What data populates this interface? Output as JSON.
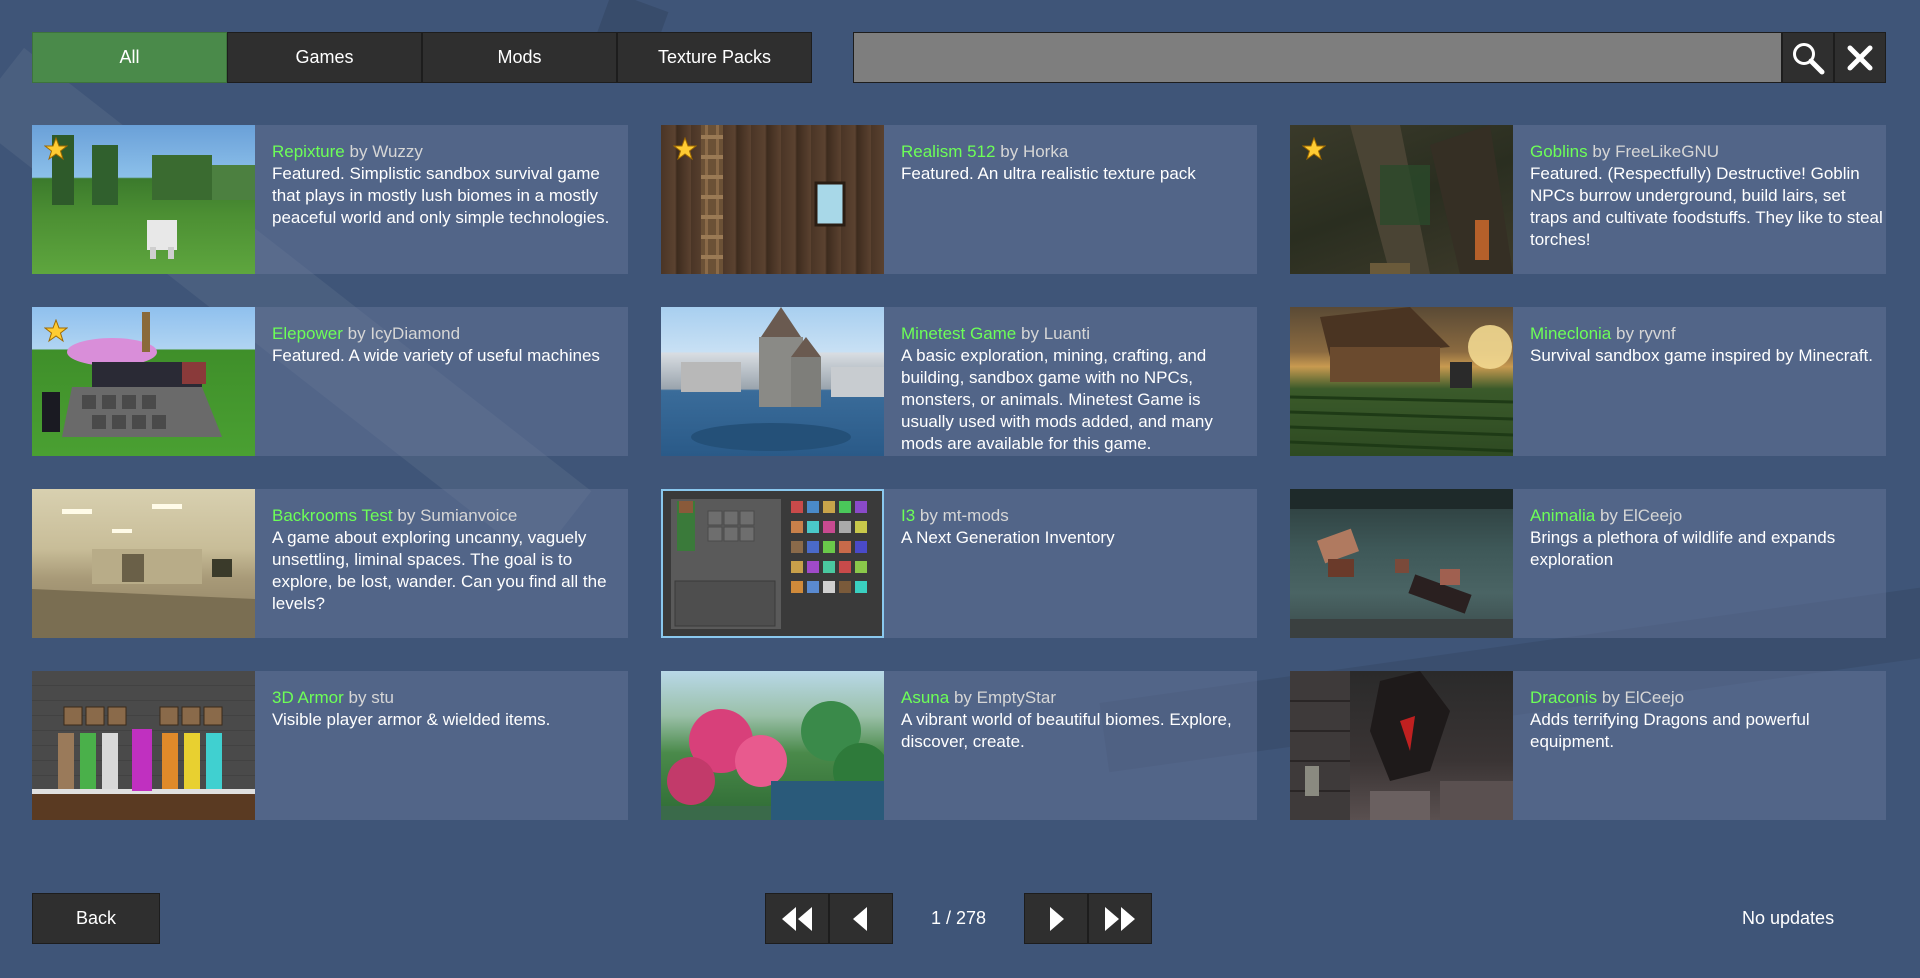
{
  "tabs": [
    {
      "label": "All",
      "active": true
    },
    {
      "label": "Games",
      "active": false
    },
    {
      "label": "Mods",
      "active": false
    },
    {
      "label": "Texture Packs",
      "active": false
    }
  ],
  "search": {
    "value": "",
    "placeholder": "",
    "search_icon": "magnifier-icon",
    "clear_icon": "close-icon"
  },
  "packages": [
    {
      "title": "Repixture",
      "by": "by",
      "author": "Wuzzy",
      "featured": true,
      "description": "Featured. Simplistic sandbox survival game that plays in mostly lush biomes in a mostly peaceful world and only simple technologies."
    },
    {
      "title": "Realism 512",
      "by": "by",
      "author": "Horka",
      "featured": true,
      "description": "Featured.  An ultra realistic texture pack"
    },
    {
      "title": "Goblins",
      "by": "by",
      "author": "FreeLikeGNU",
      "featured": true,
      "description": "Featured. (Respectfully) Destructive! Goblin NPCs burrow underground, build lairs, set traps and cultivate foodstuffs.  They like to steal torches!"
    },
    {
      "title": "Elepower",
      "by": "by",
      "author": "IcyDiamond",
      "featured": true,
      "description": "Featured. A wide variety of useful machines"
    },
    {
      "title": "Minetest Game",
      "by": "by",
      "author": "Luanti",
      "featured": false,
      "description": "A basic exploration, mining, crafting, and building, sandbox game with no NPCs, monsters, or animals. Minetest Game is usually used with mods added, and many mods are available for this game."
    },
    {
      "title": "Mineclonia",
      "by": "by",
      "author": "ryvnf",
      "featured": false,
      "description": "Survival sandbox game inspired by Minecraft."
    },
    {
      "title": "Backrooms Test",
      "by": "by",
      "author": "Sumianvoice",
      "featured": false,
      "description": "A game about exploring uncanny, vaguely unsettling, liminal spaces. The goal is to explore, be lost, wander. Can you find all the levels?"
    },
    {
      "title": "I3",
      "by": "by",
      "author": "mt-mods",
      "featured": false,
      "description": "A Next Generation Inventory"
    },
    {
      "title": "Animalia",
      "by": "by",
      "author": "ElCeejo",
      "featured": false,
      "description": "Brings a plethora of wildlife and expands exploration"
    },
    {
      "title": "3D Armor",
      "by": "by",
      "author": "stu",
      "featured": false,
      "description": "Visible player armor & wielded items."
    },
    {
      "title": "Asuna",
      "by": "by",
      "author": "EmptyStar",
      "featured": false,
      "description": "A vibrant world of beautiful biomes. Explore, discover, create."
    },
    {
      "title": "Draconis",
      "by": "by",
      "author": "ElCeejo",
      "featured": false,
      "description": "Adds terrifying Dragons and powerful equipment."
    }
  ],
  "footer": {
    "back_label": "Back",
    "page_label": "1 / 278",
    "status": "No updates"
  },
  "colors": {
    "background": "#3f5578",
    "title_green": "#6dff57",
    "active_tab": "#4a8a4a",
    "button": "#2f2f2f"
  }
}
